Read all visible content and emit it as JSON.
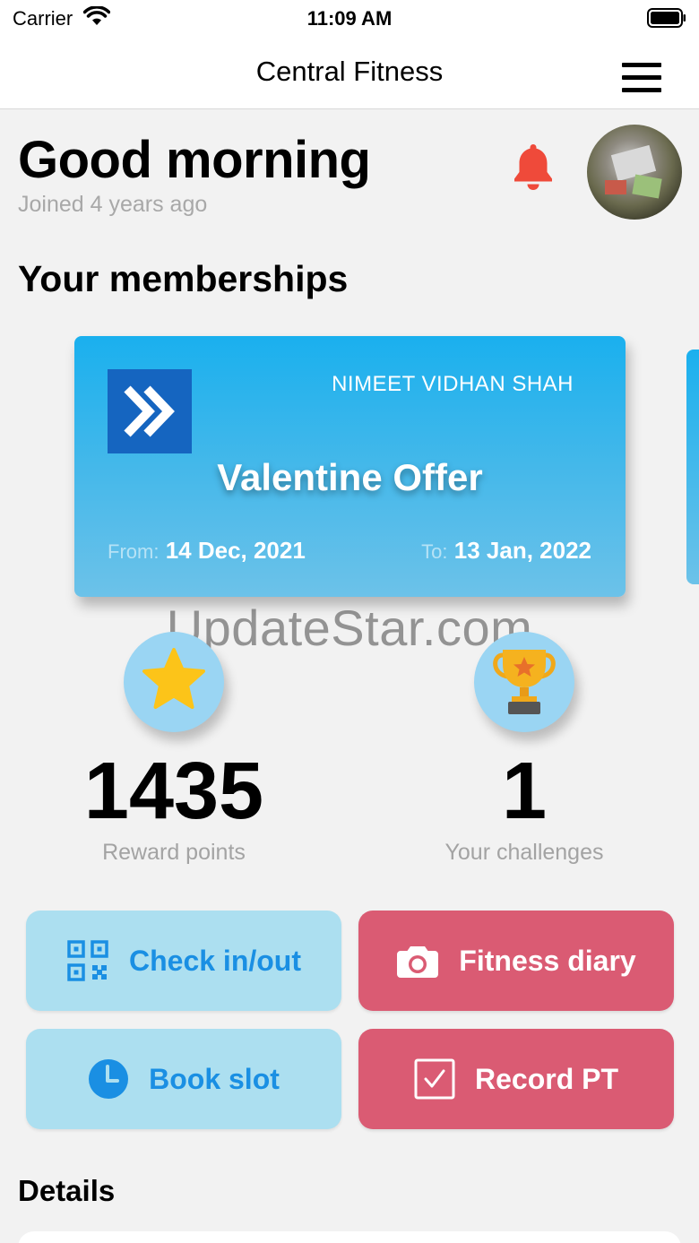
{
  "status_bar": {
    "carrier": "Carrier",
    "time": "11:09 AM"
  },
  "header": {
    "title": "Central Fitness"
  },
  "greeting": {
    "text": "Good morning",
    "joined": "Joined 4 years ago"
  },
  "memberships": {
    "section_title": "Your memberships",
    "card": {
      "member_name": "NIMEET VIDHAN SHAH",
      "plan": "Valentine Offer",
      "from_label": "From:",
      "from_date": "14 Dec, 2021",
      "to_label": "To:",
      "to_date": "13 Jan, 2022"
    }
  },
  "watermark": "UpdateStar.com",
  "stats": [
    {
      "value": "1435",
      "label": "Reward points",
      "icon": "star-icon"
    },
    {
      "value": "1",
      "label": "Your challenges",
      "icon": "trophy-icon"
    }
  ],
  "actions": [
    {
      "label": "Check in/out",
      "icon": "qr-code-icon",
      "style": "blue"
    },
    {
      "label": "Fitness diary",
      "icon": "camera-icon",
      "style": "red"
    },
    {
      "label": "Book slot",
      "icon": "clock-icon",
      "style": "blue"
    },
    {
      "label": "Record PT",
      "icon": "checkbox-icon",
      "style": "red"
    }
  ],
  "details": {
    "title": "Details"
  },
  "colors": {
    "accent_blue": "#1a8fe3",
    "action_blue_bg": "#acdff0",
    "action_red_bg": "#da5b73",
    "card_blue": "#1ab0ee",
    "bell_red": "#ef4a3a",
    "star_yellow": "#fcc419"
  }
}
